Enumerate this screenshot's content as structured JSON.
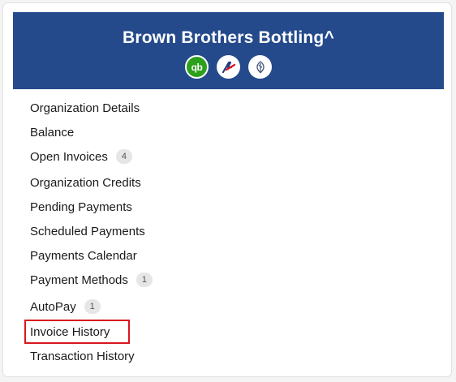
{
  "header": {
    "org_name": "Brown Brothers Bottling^",
    "integrations": [
      {
        "icon": "quickbooks-icon",
        "label": "qb"
      },
      {
        "icon": "accounting-a-icon"
      },
      {
        "icon": "tree-leaf-icon"
      }
    ],
    "colors": {
      "banner": "#244a8c",
      "qb": "#2ca01c",
      "highlight": "#d9161e"
    }
  },
  "nav": {
    "items": [
      {
        "label": "Organization Details"
      },
      {
        "label": "Balance"
      },
      {
        "label": "Open Invoices",
        "badge": "4"
      },
      {
        "label": "Organization Credits"
      },
      {
        "label": "Pending Payments"
      },
      {
        "label": "Scheduled Payments"
      },
      {
        "label": "Payments Calendar"
      },
      {
        "label": "Payment Methods",
        "badge": "1"
      },
      {
        "label": "AutoPay",
        "badge": "1"
      },
      {
        "label": "Invoice History",
        "highlighted": true
      },
      {
        "label": "Transaction History"
      }
    ]
  }
}
